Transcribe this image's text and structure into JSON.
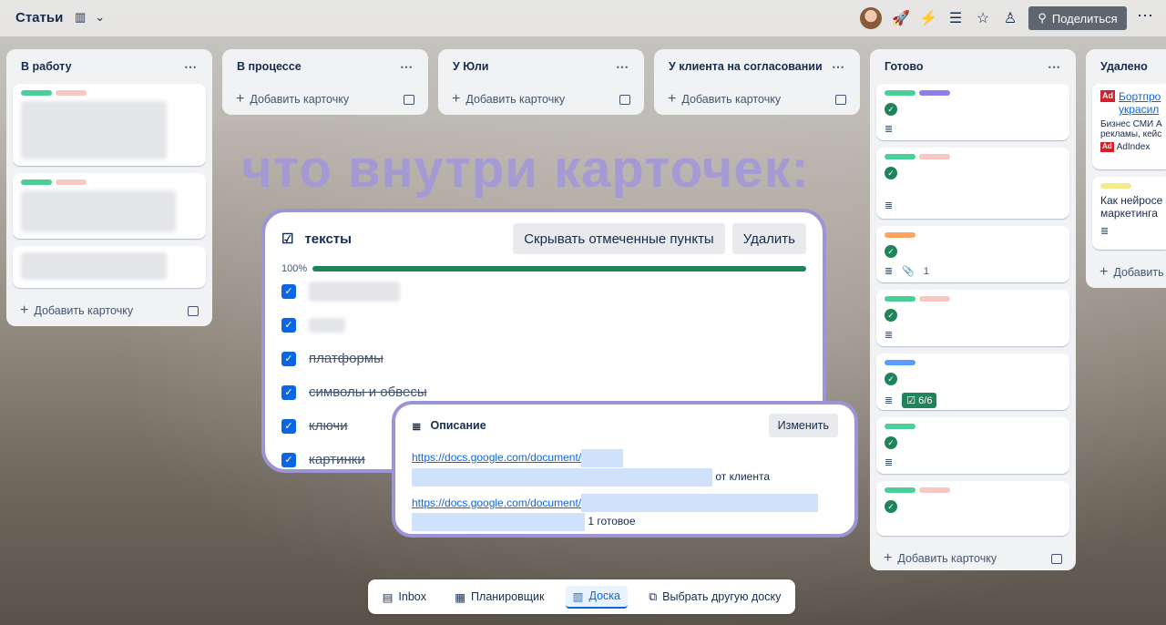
{
  "board": {
    "title": "Статьи",
    "view_icon": "board-view-icon"
  },
  "header": {
    "share_label": "Поделиться"
  },
  "lists": [
    {
      "title": "В работу",
      "add_label": "Добавить карточку"
    },
    {
      "title": "В процессе",
      "add_label": "Добавить карточку"
    },
    {
      "title": "У Юли",
      "add_label": "Добавить карточку"
    },
    {
      "title": "У клиента на согласовании",
      "add_label": "Добавить карточку"
    },
    {
      "title": "Готово",
      "add_label": "Добавить карточку",
      "card_attachments": "1",
      "card_checklist": "6/6"
    },
    {
      "title": "Удалено",
      "add_label": "Добавить",
      "card1_title": "Бортпро украсил",
      "card1_text": "Бизнес СМИ А рекламы, кейс",
      "card1_source": "AdIndex",
      "card2_text": "Как нейросе маркетинга"
    }
  ],
  "overlay_title": "что внутри карточек:",
  "checklist": {
    "title": "тексты",
    "hide_label": "Скрывать отмеченные пункты",
    "delete_label": "Удалить",
    "progress_label": "100%",
    "progress": 1.0,
    "items": [
      "платформы",
      "символы и обвесы",
      "ключи",
      "картинки"
    ]
  },
  "description": {
    "title": "Описание",
    "edit_label": "Изменить",
    "link1": "https://docs.google.com/document/",
    "link1_suffix": "от клиента",
    "link2": "https://docs.google.com/document/",
    "link2_suffix": "1 готовое"
  },
  "bottom_nav": {
    "inbox": "Inbox",
    "planner": "Планировщик",
    "board": "Доска",
    "switch": "Выбрать другую доску"
  },
  "colors": {
    "green": "#4bce97",
    "pink": "#f8c7c2",
    "purple": "#8f7ee7",
    "orange": "#fea362",
    "blue": "#579dff",
    "yellow": "#f5e989"
  }
}
